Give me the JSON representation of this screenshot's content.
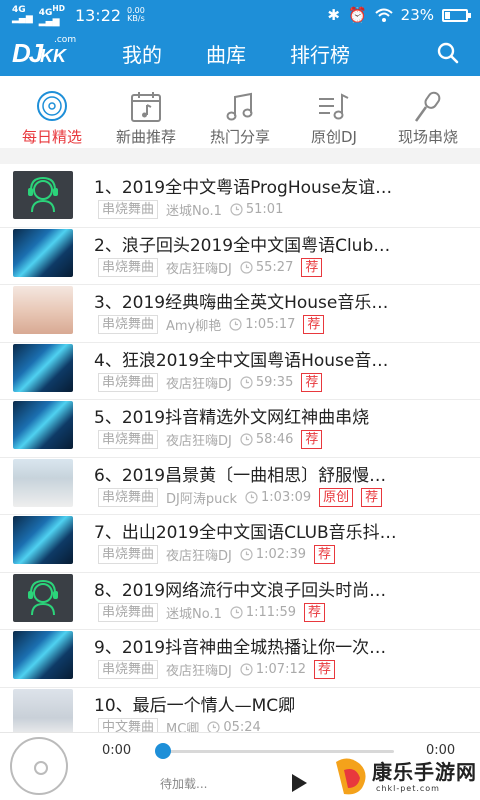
{
  "status": {
    "network_1": "4G",
    "network_2": "4G",
    "network_2_suffix": "HD",
    "time": "13:22",
    "speed_value": "0.00",
    "speed_unit": "KB/s",
    "battery_text": "23%",
    "battery_level": 0.23
  },
  "header": {
    "logo_dj": "DJ",
    "logo_kk": "KK",
    "logo_com": ".com",
    "tabs": [
      "我的",
      "曲库",
      "排行榜"
    ]
  },
  "categories": [
    {
      "label": "每日精选",
      "icon": "disc-icon",
      "active": true
    },
    {
      "label": "新曲推荐",
      "icon": "calendar-music-icon",
      "active": false
    },
    {
      "label": "热门分享",
      "icon": "music-note-icon",
      "active": false
    },
    {
      "label": "原创DJ",
      "icon": "music-list-icon",
      "active": false
    },
    {
      "label": "现场串烧",
      "icon": "microphone-icon",
      "active": false
    }
  ],
  "songs": [
    {
      "title": "1、2019全中文粤语ProgHouse友谊…",
      "genre": "串烧舞曲",
      "artist": "迷城No.1",
      "duration": "51:01",
      "badges": [],
      "thumb": "dj"
    },
    {
      "title": "2、浪子回头2019全中文国粤语Club…",
      "genre": "串烧舞曲",
      "artist": "夜店狂嗨DJ",
      "duration": "55:27",
      "badges": [
        "荐"
      ],
      "thumb": "club"
    },
    {
      "title": "3、2019经典嗨曲全英文House音乐…",
      "genre": "串烧舞曲",
      "artist": "Amy柳艳",
      "duration": "1:05:17",
      "badges": [
        "荐"
      ],
      "thumb": "girl"
    },
    {
      "title": "4、狂浪2019全中文国粤语House音…",
      "genre": "串烧舞曲",
      "artist": "夜店狂嗨DJ",
      "duration": "59:35",
      "badges": [
        "荐"
      ],
      "thumb": "club"
    },
    {
      "title": "5、2019抖音精选外文网红神曲串烧",
      "genre": "串烧舞曲",
      "artist": "夜店狂嗨DJ",
      "duration": "58:46",
      "badges": [
        "荐"
      ],
      "thumb": "club"
    },
    {
      "title": "6、2019昌景黄〔一曲相思〕舒服慢…",
      "genre": "串烧舞曲",
      "artist": "DJ阿涛puck",
      "duration": "1:03:09",
      "badges": [
        "原创",
        "荐"
      ],
      "thumb": "man"
    },
    {
      "title": "7、出山2019全中文国语CLUB音乐抖…",
      "genre": "串烧舞曲",
      "artist": "夜店狂嗨DJ",
      "duration": "1:02:39",
      "badges": [
        "荐"
      ],
      "thumb": "club"
    },
    {
      "title": "8、2019网络流行中文浪子回头时尚…",
      "genre": "串烧舞曲",
      "artist": "迷城No.1",
      "duration": "1:11:59",
      "badges": [
        "荐"
      ],
      "thumb": "dj"
    },
    {
      "title": "9、2019抖音神曲全城热播让你一次…",
      "genre": "串烧舞曲",
      "artist": "夜店狂嗨DJ",
      "duration": "1:07:12",
      "badges": [
        "荐"
      ],
      "thumb": "club"
    },
    {
      "title": "10、最后一个情人—MC卿",
      "genre": "中文舞曲",
      "artist": "MC卿",
      "duration": "05:24",
      "badges": [],
      "thumb": "boy"
    }
  ],
  "player": {
    "current_time": "0:00",
    "total_time": "0:00",
    "loading_text": "待加载...",
    "progress": 0
  },
  "watermark": {
    "title": "康乐手游网",
    "url": "chkl-pet.com"
  },
  "colors": {
    "brand_blue": "#1e8fd8",
    "accent_red": "#e8383d"
  }
}
